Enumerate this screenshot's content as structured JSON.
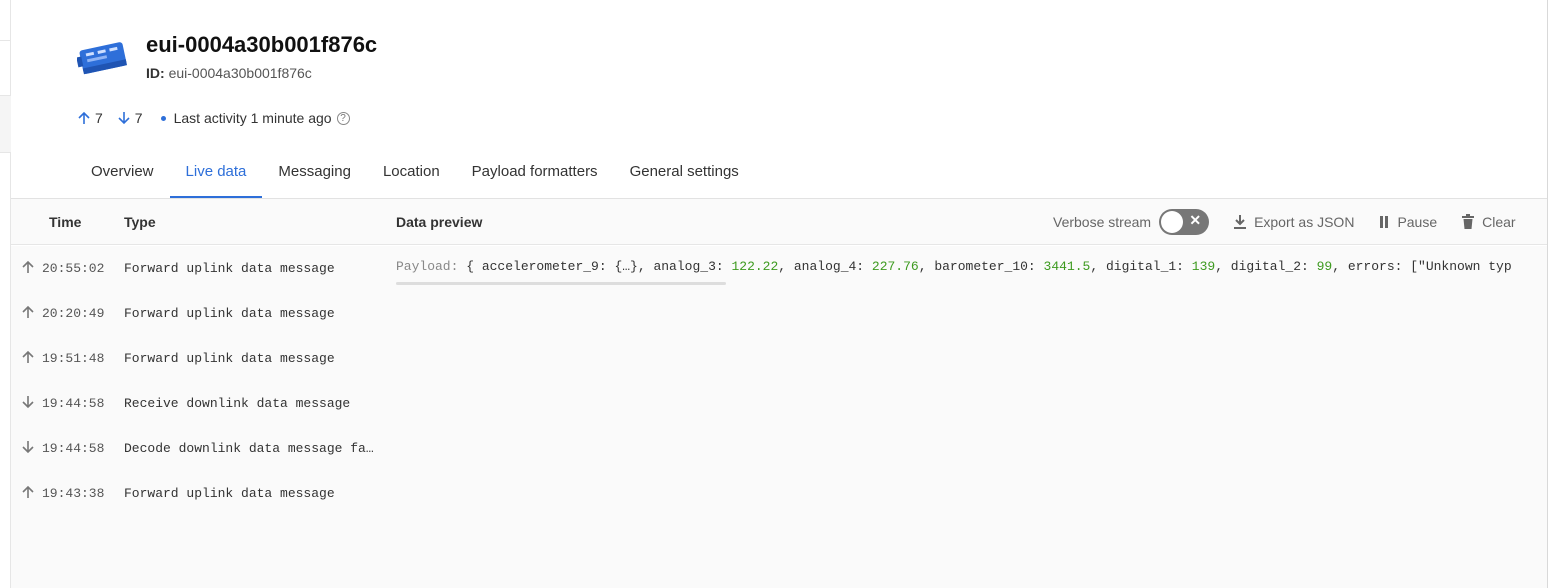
{
  "device": {
    "title": "eui-0004a30b001f876c",
    "id_label": "ID:",
    "id_value": "eui-0004a30b001f876c",
    "uplink_count": "7",
    "downlink_count": "7",
    "last_activity": "Last activity 1 minute ago",
    "accent_color": "#2e6fd9"
  },
  "tabs": [
    {
      "label": "Overview"
    },
    {
      "label": "Live data"
    },
    {
      "label": "Messaging"
    },
    {
      "label": "Location"
    },
    {
      "label": "Payload formatters"
    },
    {
      "label": "General settings"
    }
  ],
  "active_tab": "Live data",
  "table": {
    "col_time": "Time",
    "col_type": "Type",
    "col_preview": "Data preview",
    "verbose_label": "Verbose stream",
    "export_label": "Export as JSON",
    "pause_label": "Pause",
    "clear_label": "Clear"
  },
  "rows": [
    {
      "direction": "up",
      "time": "20:55:02",
      "type": "Forward uplink data message",
      "has_preview": true
    },
    {
      "direction": "up",
      "time": "20:20:49",
      "type": "Forward uplink data message",
      "has_preview": false
    },
    {
      "direction": "up",
      "time": "19:51:48",
      "type": "Forward uplink data message",
      "has_preview": false
    },
    {
      "direction": "down",
      "time": "19:44:58",
      "type": "Receive downlink data message",
      "has_preview": false
    },
    {
      "direction": "down",
      "time": "19:44:58",
      "type": "Decode downlink data message fa…",
      "has_preview": false
    },
    {
      "direction": "up",
      "time": "19:43:38",
      "type": "Forward uplink data message",
      "has_preview": false
    }
  ],
  "preview": {
    "label": "Payload:",
    "open": " { accelerometer_9: {…}, analog_3: ",
    "v1": "122.22",
    "s1": ", analog_4: ",
    "v2": "227.76",
    "s2": ", barometer_10: ",
    "v3": "3441.5",
    "s3": ", digital_1: ",
    "v4": "139",
    "s4": ", digital_2: ",
    "v5": "99",
    "s5": ", errors: [\"Unknown typ"
  }
}
